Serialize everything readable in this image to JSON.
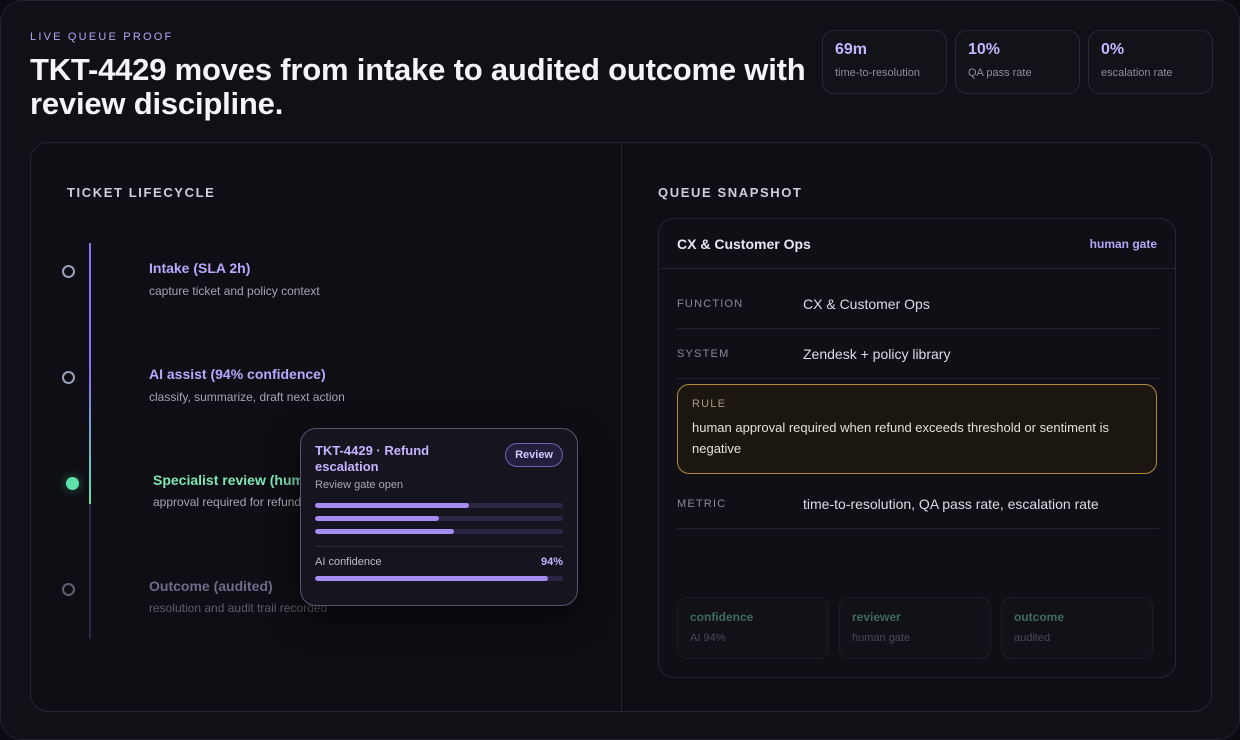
{
  "header": {
    "eyebrow": "LIVE QUEUE PROOF",
    "title": "TKT-4429 moves from intake to audited outcome with review discipline."
  },
  "metrics": [
    {
      "value": "69m",
      "label": "time-to-resolution"
    },
    {
      "value": "10%",
      "label": "QA pass rate"
    },
    {
      "value": "0%",
      "label": "escalation rate"
    }
  ],
  "lifecycle": {
    "title": "TICKET LIFECYCLE",
    "steps": [
      {
        "title": "Intake (SLA 2h)",
        "sub": "capture ticket and policy context",
        "state": "done"
      },
      {
        "title": "AI assist (94% confidence)",
        "sub": "classify, summarize, draft next action",
        "state": "done"
      },
      {
        "title": "Specialist review (human gate)",
        "sub": "approval required for refund",
        "state": "active"
      },
      {
        "title": "Outcome (audited)",
        "sub": "resolution and audit trail recorded",
        "state": "pending"
      }
    ]
  },
  "popup": {
    "title": "TKT-4429 · Refund escalation",
    "subtitle": "Review gate open",
    "badge": "Review",
    "progress_bars": [
      0.62,
      0.5,
      0.56
    ],
    "confidence_label": "AI confidence",
    "confidence_value": "94%",
    "confidence_fraction": 0.94
  },
  "snapshot": {
    "section_title": "QUEUE SNAPSHOT",
    "card_title": "CX & Customer Ops",
    "card_tag": "human gate",
    "rows": {
      "function": {
        "key": "FUNCTION",
        "value": "CX & Customer Ops"
      },
      "system": {
        "key": "SYSTEM",
        "value": "Zendesk + policy library"
      },
      "metric": {
        "key": "METRIC",
        "value": "time-to-resolution, QA pass rate, escalation rate"
      }
    },
    "rule": {
      "key": "RULE",
      "value": "human approval required when refund exceeds threshold or sentiment is negative"
    },
    "mini_cards": [
      {
        "title": "confidence",
        "sub": "AI 94%"
      },
      {
        "title": "reviewer",
        "sub": "human gate"
      },
      {
        "title": "outcome",
        "sub": "audited"
      }
    ]
  },
  "colors": {
    "accent": "#b8a4f6",
    "active": "#5fe1a8",
    "rule_border": "#b08a3e"
  }
}
